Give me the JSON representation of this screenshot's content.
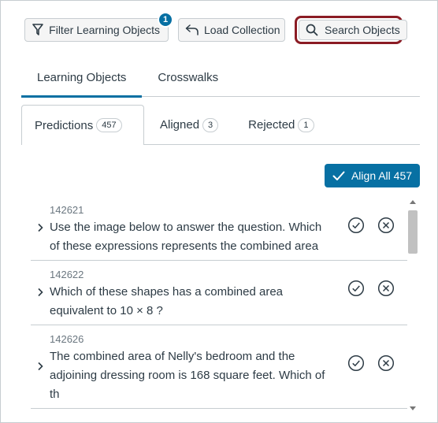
{
  "toolbar": {
    "filter_label": "Filter Learning Objects",
    "filter_badge": "1",
    "load_label": "Load Collection",
    "search_label": "Search Objects"
  },
  "top_tabs": [
    {
      "label": "Learning Objects",
      "active": true
    },
    {
      "label": "Crosswalks",
      "active": false
    }
  ],
  "sub_tabs": [
    {
      "label": "Predictions",
      "count": "457",
      "active": true
    },
    {
      "label": "Aligned",
      "count": "3",
      "active": false
    },
    {
      "label": "Rejected",
      "count": "1",
      "active": false
    }
  ],
  "align_all_label": "Align All 457",
  "items": [
    {
      "id": "142621",
      "lines": [
        "Use the image below to answer the question. Which",
        "of these expressions represents the combined area"
      ]
    },
    {
      "id": "142622",
      "lines": [
        "Which of these shapes has a combined area",
        "equivalent to 10 × 8 ?"
      ]
    },
    {
      "id": "142626",
      "lines": [
        "The combined area of Nelly's bedroom and the",
        "adjoining dressing room is 168 square feet. Which of",
        "th"
      ]
    }
  ],
  "colors": {
    "accent": "#0770a3",
    "highlight": "#8b1c24"
  },
  "icons": {
    "filter": "filter-icon",
    "load": "undo-arrow-icon",
    "search": "search-icon",
    "check": "check-icon",
    "approve": "check-circle-icon",
    "reject": "x-circle-icon",
    "expand": "chevron-right-icon"
  }
}
